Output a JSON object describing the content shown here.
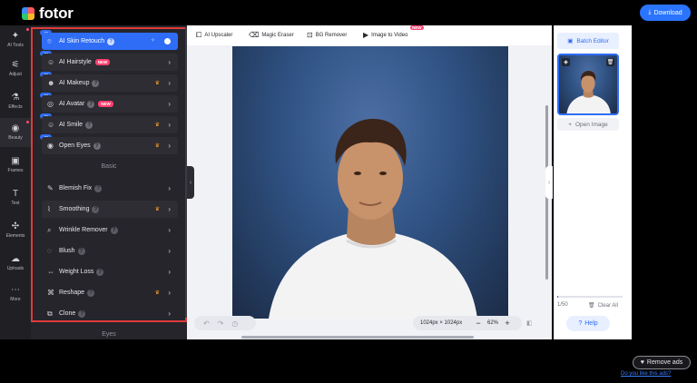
{
  "brand": {
    "name": "fotor"
  },
  "header": {
    "download_label": "Download"
  },
  "rail": [
    {
      "label": "AI Tools",
      "icon": "sparkle-icon"
    },
    {
      "label": "Adjust",
      "icon": "sliders-icon"
    },
    {
      "label": "Effects",
      "icon": "flask-icon"
    },
    {
      "label": "Beauty",
      "icon": "eye-icon"
    },
    {
      "label": "Frames",
      "icon": "frame-icon"
    },
    {
      "label": "Text",
      "icon": "text-icon"
    },
    {
      "label": "Elements",
      "icon": "shapes-icon"
    },
    {
      "label": "Uploads",
      "icon": "cloud-upload-icon"
    },
    {
      "label": "More",
      "icon": "more-icon"
    }
  ],
  "panel": {
    "ai_badge": "AI",
    "new_badge": "NEW",
    "ai_items": [
      {
        "label": "AI Skin Retouch",
        "new": false,
        "premium": false,
        "active": true
      },
      {
        "label": "AI Hairstyle",
        "new": true,
        "premium": false,
        "active": false
      },
      {
        "label": "AI Makeup",
        "new": false,
        "premium": true,
        "active": false
      },
      {
        "label": "AI Avatar",
        "new": true,
        "premium": false,
        "active": false
      },
      {
        "label": "AI Smile",
        "new": false,
        "premium": true,
        "active": false
      },
      {
        "label": "Open Eyes",
        "new": false,
        "premium": true,
        "active": false
      }
    ],
    "basic_heading": "Basic",
    "basic_items": [
      {
        "label": "Blemish Fix",
        "premium": false
      },
      {
        "label": "Smoothing",
        "premium": true
      },
      {
        "label": "Wrinkle Remover",
        "premium": false
      },
      {
        "label": "Blush",
        "premium": false
      },
      {
        "label": "Weight Loss",
        "premium": false
      },
      {
        "label": "Reshape",
        "premium": true
      },
      {
        "label": "Clone",
        "premium": false
      }
    ],
    "eyes_heading": "Eyes"
  },
  "toolbar": {
    "items": [
      {
        "label": "AI Upscaler",
        "icon": "upscale-icon"
      },
      {
        "label": "Magic Eraser",
        "icon": "eraser-icon"
      },
      {
        "label": "BG Remover",
        "icon": "bg-remove-icon"
      },
      {
        "label": "Image to Video",
        "icon": "video-icon"
      }
    ],
    "video_badge": "NEW"
  },
  "canvas": {
    "image_size": "1024px × 1024px",
    "zoom": "62%"
  },
  "right_panel": {
    "batch_label": "Batch Editor",
    "open_image_label": "Open Image",
    "count": "1/50",
    "count_fraction": 0.02,
    "clear_all_label": "Clear All",
    "help_label": "Help"
  },
  "ads": {
    "remove_label": "Remove ads",
    "report_label": "Do you like this ads?"
  },
  "colors": {
    "accent": "#2f6df6",
    "highlight_outline": "#e03a3a",
    "premium_crown": "#ff9f2e",
    "new_badge": "#ff3f6e"
  }
}
